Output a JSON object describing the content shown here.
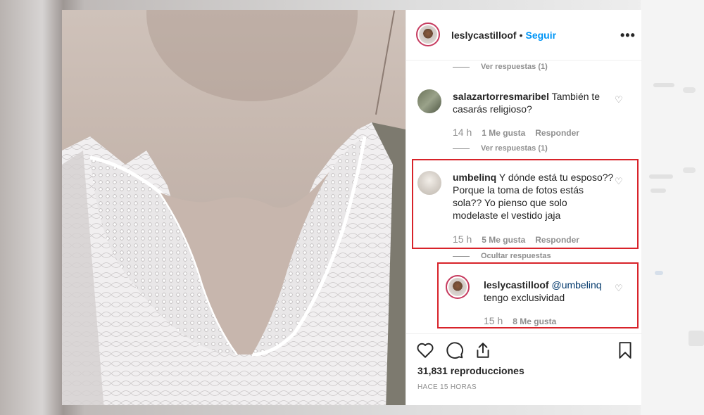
{
  "post": {
    "author": "leslycastilloof",
    "follow_separator": "•",
    "follow_label": "Seguir",
    "more_icon": "more-options-icon"
  },
  "comments": [
    {
      "view_replies": "Ver respuestas (1)"
    },
    {
      "username": "salazartorresmaribel",
      "text": "También te casarás religioso?",
      "time": "14 h",
      "likes": "1 Me gusta",
      "reply": "Responder",
      "view_replies": "Ver respuestas (1)"
    },
    {
      "username": "umbelinq",
      "text": "Y dónde está tu esposo?? Porque la toma de fotos estás sola?? Yo pienso que solo modelaste el vestido jaja",
      "time": "15 h",
      "likes": "5 Me gusta",
      "reply": "Responder",
      "hide_replies": "Ocultar respuestas"
    }
  ],
  "reply": {
    "username": "leslycastilloof",
    "mention": "@umbelinq",
    "text": "tengo exclusividad",
    "time": "15 h",
    "likes": "8 Me gusta"
  },
  "footer": {
    "views": "31,831 reproducciones",
    "posted": "HACE 15 HORAS"
  },
  "colors": {
    "highlight": "#d8232a",
    "link": "#0095f6",
    "muted": "#8e8e8e"
  }
}
